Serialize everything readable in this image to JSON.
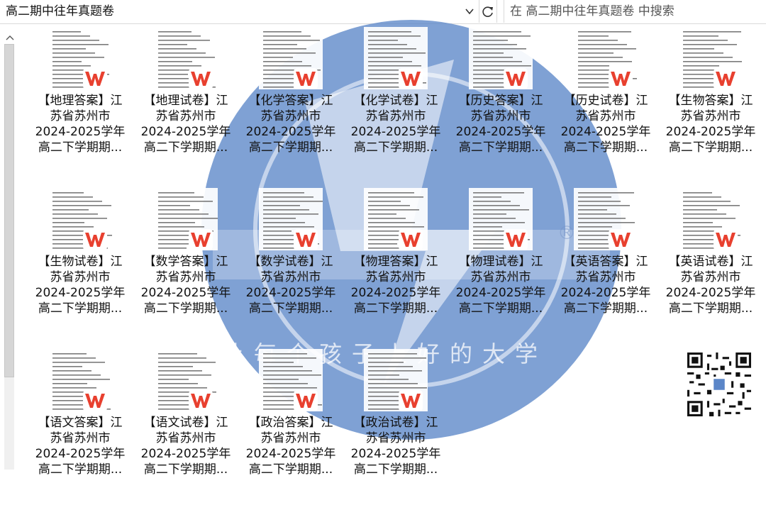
{
  "address_bar": {
    "path": "高二期中往年真题卷"
  },
  "search": {
    "placeholder": "在 高二期中往年真题卷 中搜索"
  },
  "colors": {
    "wps_red": "#e8402f",
    "watermark_blue": "#5b86c8",
    "text": "#111111"
  },
  "icons": {
    "chevron": "chevron-down-icon",
    "refresh": "refresh-icon",
    "wps": "wps-logo-icon",
    "qr": "qr-code-icon"
  },
  "watermark": {
    "slogan": "让每个孩子上好的大学"
  },
  "files": [
    {
      "line1": "【地理答案】江",
      "line2": "苏省苏州市",
      "line3": "2024-2025学年",
      "line4": "高二下学期期..."
    },
    {
      "line1": "【地理试卷】江",
      "line2": "苏省苏州市",
      "line3": "2024-2025学年",
      "line4": "高二下学期期..."
    },
    {
      "line1": "【化学答案】江",
      "line2": "苏省苏州市",
      "line3": "2024-2025学年",
      "line4": "高二下学期期..."
    },
    {
      "line1": "【化学试卷】江",
      "line2": "苏省苏州市",
      "line3": "2024-2025学年",
      "line4": "高二下学期期..."
    },
    {
      "line1": "【历史答案】江",
      "line2": "苏省苏州市",
      "line3": "2024-2025学年",
      "line4": "高二下学期期..."
    },
    {
      "line1": "【历史试卷】江",
      "line2": "苏省苏州市",
      "line3": "2024-2025学年",
      "line4": "高二下学期期..."
    },
    {
      "line1": "【生物答案】江",
      "line2": "苏省苏州市",
      "line3": "2024-2025学年",
      "line4": "高二下学期期..."
    },
    {
      "line1": "【生物试卷】江",
      "line2": "苏省苏州市",
      "line3": "2024-2025学年",
      "line4": "高二下学期期..."
    },
    {
      "line1": "【数学答案】江",
      "line2": "苏省苏州市",
      "line3": "2024-2025学年",
      "line4": "高二下学期期..."
    },
    {
      "line1": "【数学试卷】江",
      "line2": "苏省苏州市",
      "line3": "2024-2025学年",
      "line4": "高二下学期期..."
    },
    {
      "line1": "【物理答案】江",
      "line2": "苏省苏州市",
      "line3": "2024-2025学年",
      "line4": "高二下学期期..."
    },
    {
      "line1": "【物理试卷】江",
      "line2": "苏省苏州市",
      "line3": "2024-2025学年",
      "line4": "高二下学期期..."
    },
    {
      "line1": "【英语答案】江",
      "line2": "苏省苏州市",
      "line3": "2024-2025学年",
      "line4": "高二下学期期..."
    },
    {
      "line1": "【英语试卷】江",
      "line2": "苏省苏州市",
      "line3": "2024-2025学年",
      "line4": "高二下学期期..."
    },
    {
      "line1": "【语文答案】江",
      "line2": "苏省苏州市",
      "line3": "2024-2025学年",
      "line4": "高二下学期期..."
    },
    {
      "line1": "【语文试卷】江",
      "line2": "苏省苏州市",
      "line3": "2024-2025学年",
      "line4": "高二下学期期..."
    },
    {
      "line1": "【政治答案】江",
      "line2": "苏省苏州市",
      "line3": "2024-2025学年",
      "line4": "高二下学期期..."
    },
    {
      "line1": "【政治试卷】江",
      "line2": "苏省苏州市",
      "line3": "2024-2025学年",
      "line4": "高二下学期期..."
    }
  ]
}
